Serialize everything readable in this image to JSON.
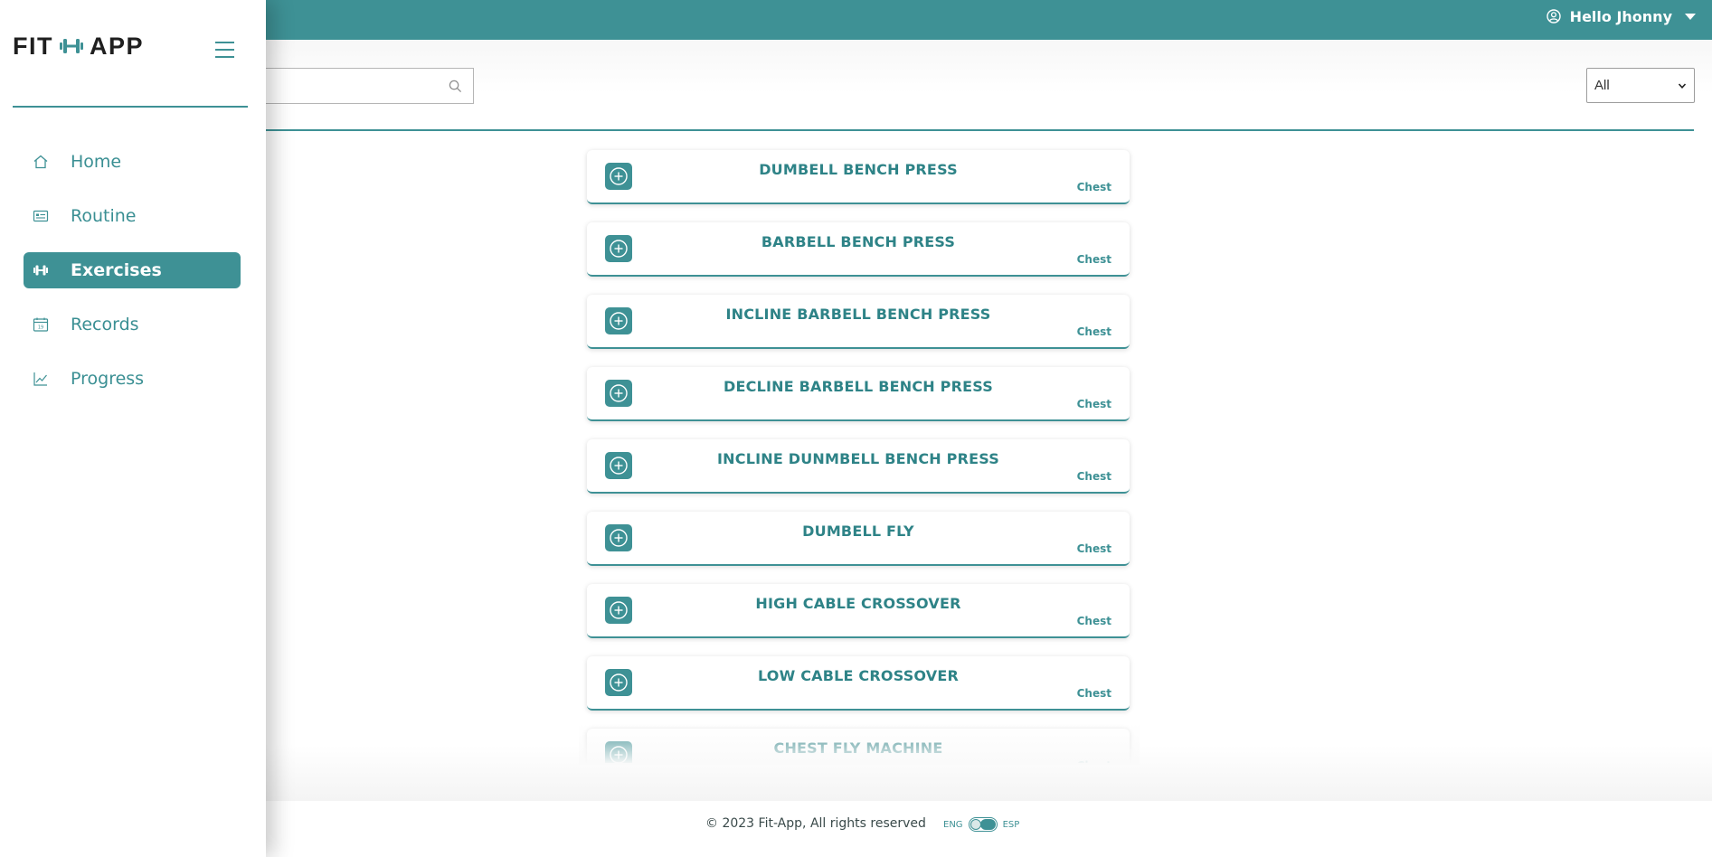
{
  "app": {
    "logo_left": "FIT",
    "logo_right": "APP"
  },
  "header": {
    "greeting": "Hello Jhonny"
  },
  "sidebar": {
    "items": [
      {
        "label": "Home",
        "icon": "home-icon",
        "active": false
      },
      {
        "label": "Routine",
        "icon": "routine-card-icon",
        "active": false
      },
      {
        "label": "Exercises",
        "icon": "dumbbell-icon",
        "active": true
      },
      {
        "label": "Records",
        "icon": "calendar-icon",
        "active": false
      },
      {
        "label": "Progress",
        "icon": "chart-line-icon",
        "active": false
      }
    ]
  },
  "search": {
    "placeholder": "",
    "value": ""
  },
  "filter": {
    "selected": "All"
  },
  "exercises": [
    {
      "name": "DUMBELL BENCH PRESS",
      "muscle": "Chest"
    },
    {
      "name": "BARBELL BENCH PRESS",
      "muscle": "Chest"
    },
    {
      "name": "INCLINE BARBELL BENCH PRESS",
      "muscle": "Chest"
    },
    {
      "name": "DECLINE BARBELL BENCH PRESS",
      "muscle": "Chest"
    },
    {
      "name": "INCLINE DUNMBELL BENCH PRESS",
      "muscle": "Chest"
    },
    {
      "name": "DUMBELL FLY",
      "muscle": "Chest"
    },
    {
      "name": "HIGH CABLE CROSSOVER",
      "muscle": "Chest"
    },
    {
      "name": "LOW CABLE CROSSOVER",
      "muscle": "Chest"
    },
    {
      "name": "CHEST FLY MACHINE",
      "muscle": "Chest"
    }
  ],
  "footer": {
    "copyright": "© 2023 Fit-App, All rights reserved",
    "lang_left": "ENG",
    "lang_right": "ESP"
  },
  "colors": {
    "accent": "#3e9195",
    "text_dark": "#1f1f1f"
  }
}
